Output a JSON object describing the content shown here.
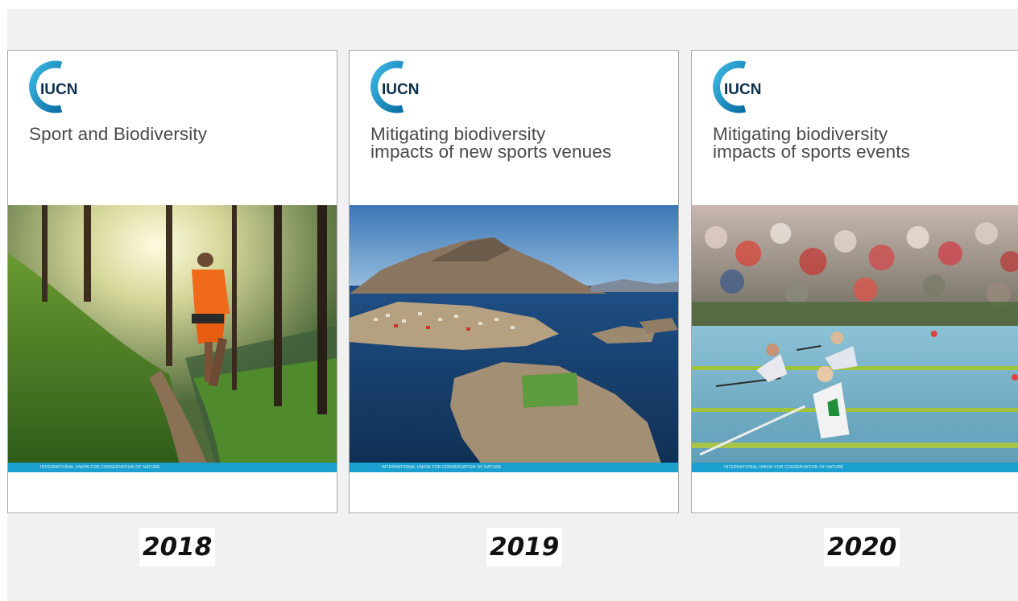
{
  "covers": [
    {
      "logo_text": "IUCN",
      "title": "Sport and Biodiversity",
      "footer": "INTERNATIONAL UNION FOR CONSERVATION OF NATURE",
      "year": "2018"
    },
    {
      "logo_text": "IUCN",
      "title": "Mitigating biodiversity\nimpacts of new sports venues",
      "footer": "INTERNATIONAL UNION FOR CONSERVATION OF NATURE",
      "year": "2019"
    },
    {
      "logo_text": "IUCN",
      "title": "Mitigating biodiversity\nimpacts of sports events",
      "footer": "INTERNATIONAL UNION FOR CONSERVATION OF NATURE",
      "year": "2020"
    }
  ],
  "colors": {
    "iucn_blue": "#1b9fce",
    "iucn_dark": "#0c2f4c",
    "panel_bg": "#f1f1f1"
  }
}
